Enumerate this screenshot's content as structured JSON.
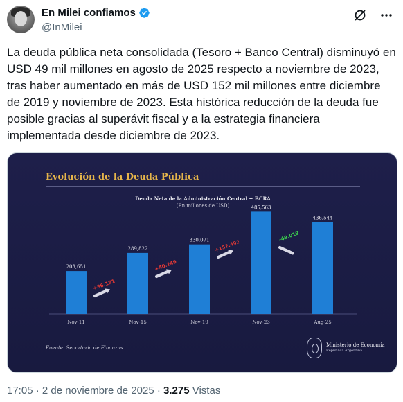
{
  "author": {
    "display_name": "En Milei confiamos",
    "handle": "@InMilei",
    "verified": true
  },
  "tweet": {
    "text": "La deuda pública neta consolidada (Tesoro + Banco Central) disminuyó en USD 49 mil millones en agosto de 2025 respecto a noviembre de 2023, tras haber aumentado en más de USD 152 mil millones entre diciembre de 2019 y noviembre de 2023. Esta histórica reducción de la deuda fue posible gracias al superávit fiscal y a la estrategia financiera implementada desde diciembre de 2023."
  },
  "icons": {
    "grok": "grok-icon",
    "more": "more-icon",
    "verified": "verified-badge-icon"
  },
  "colors": {
    "bar": "#1f7fd6",
    "increase": "#e53935",
    "decrease": "#3ccf4e",
    "title": "#e6b54a",
    "background": "#1b1d45"
  },
  "chart_data": {
    "type": "bar",
    "title": "Evolución de la Deuda Pública",
    "subtitle": "Deuda Neta de la Administración Central + BCRA",
    "unit_label": "(En millones de USD)",
    "categories": [
      "Nov-11",
      "Nov-15",
      "Nov-19",
      "Nov-23",
      "Aug-25"
    ],
    "values": [
      203651,
      289822,
      330071,
      485563,
      436544
    ],
    "value_labels": [
      "203,651",
      "289,822",
      "330,071",
      "485,563",
      "436,544"
    ],
    "changes": [
      {
        "label": "+86.171",
        "direction": "up"
      },
      {
        "label": "+40.249",
        "direction": "up"
      },
      {
        "label": "+152.492",
        "direction": "up"
      },
      {
        "label": "-49.019",
        "direction": "down"
      }
    ],
    "ylim": [
      0,
      500000
    ],
    "source": "Fuente: Secretaría de Finanzas"
  },
  "ministry": {
    "name": "Ministerio de Economía",
    "country": "República Argentina"
  },
  "footer": {
    "time": "17:05",
    "separator": " · ",
    "date": "2 de noviembre de 2025",
    "views_count": "3.275",
    "views_label": " Vistas"
  }
}
